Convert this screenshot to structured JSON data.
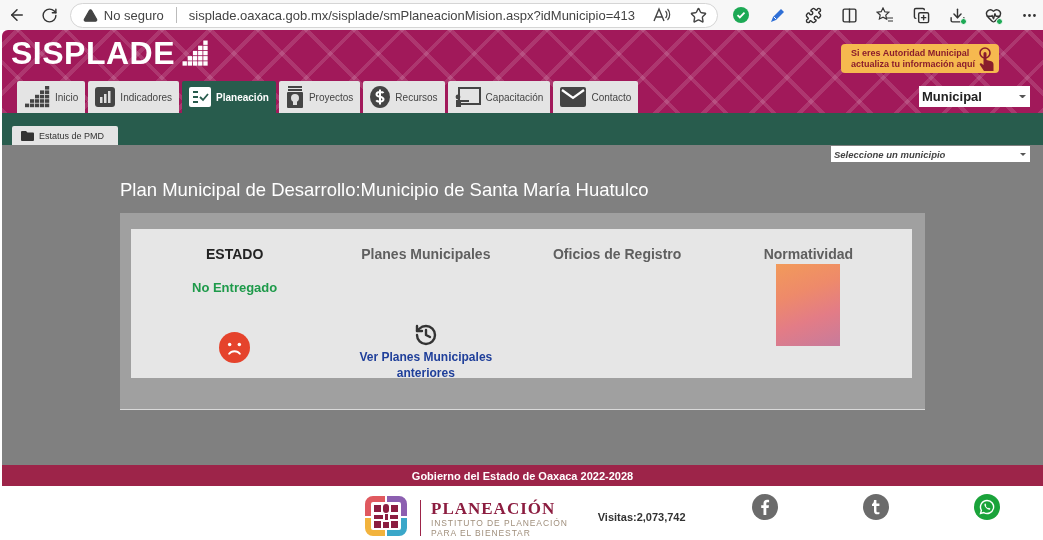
{
  "browser": {
    "security_label": "No seguro",
    "url": "sisplade.oaxaca.gob.mx/sisplade/smPlaneacionMision.aspx?idMunicipio=413"
  },
  "header": {
    "logo": "SISPLADE",
    "authority_button": [
      "Si eres Autoridad Municipal",
      "actualiza tu información aquí"
    ],
    "nav_tabs": [
      {
        "label": "Inicio",
        "selected": false
      },
      {
        "label": "Indicadores",
        "selected": false
      },
      {
        "label": "Planeación",
        "selected": true
      },
      {
        "label": "Proyectos",
        "selected": false
      },
      {
        "label": "Recursos",
        "selected": false
      },
      {
        "label": "Capacitación",
        "selected": false
      },
      {
        "label": "Contacto",
        "selected": false
      }
    ],
    "level_select": {
      "value": "Municipal"
    }
  },
  "subtabs": [
    {
      "label": "Estatus de PMD",
      "selected": true
    }
  ],
  "municipality_select": {
    "placeholder": "Seleccione un municipio"
  },
  "page_title": "Plan Municipal de Desarrollo:Municipio de Santa María Huatulco",
  "status_panel": {
    "columns": [
      {
        "kind": "status",
        "heading": "ESTADO",
        "status": "No Entregado"
      },
      {
        "kind": "history",
        "heading": "Planes Municipales",
        "link": "Ver Planes Municipales anteriores"
      },
      {
        "kind": "empty",
        "heading": "Oficios de Registro"
      },
      {
        "kind": "document",
        "heading": "Normatividad"
      }
    ]
  },
  "footer": {
    "government_line": "Gobierno del Estado de Oaxaca 2022-2028",
    "institute": {
      "name": "PLANEACIÓN",
      "subtitle_lines": [
        "INSTITUTO DE PLANEACIÓN",
        "PARA EL BIENESTAR"
      ]
    },
    "visits": "Visitas:2,073,742"
  }
}
